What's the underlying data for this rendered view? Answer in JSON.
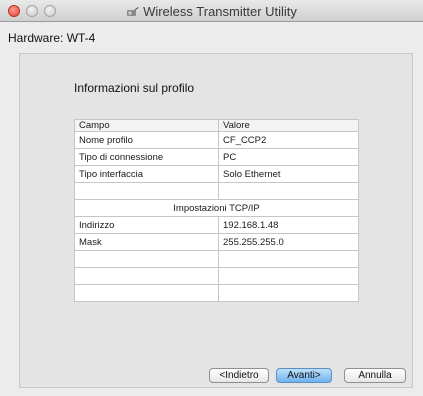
{
  "window": {
    "title": "Wireless Transmitter Utility"
  },
  "hardware_label": "Hardware: WT-4",
  "panel": {
    "heading": "Informazioni sul profilo"
  },
  "table": {
    "header": {
      "field": "Campo",
      "value": "Valore"
    },
    "rows": [
      {
        "field": "Nome profilo",
        "value": "CF_CCP2"
      },
      {
        "field": "Tipo di connessione",
        "value": "PC"
      },
      {
        "field": "Tipo interfaccia",
        "value": "Solo Ethernet"
      },
      {
        "field": "",
        "value": ""
      },
      {
        "section": "Impostazioni TCP/IP"
      },
      {
        "field": "Indirizzo",
        "value": "192.168.1.48"
      },
      {
        "field": "Mask",
        "value": "255.255.255.0"
      },
      {
        "field": "",
        "value": ""
      },
      {
        "field": "",
        "value": ""
      },
      {
        "field": "",
        "value": ""
      }
    ]
  },
  "buttons": {
    "back": "<Indietro",
    "next": "Avanti>",
    "cancel": "Annulla"
  },
  "icons": {
    "close": "traffic-light-close",
    "minimize": "traffic-light-minimize",
    "zoom": "traffic-light-zoom",
    "app": "wireless-transmitter-icon"
  },
  "colors": {
    "close_light": "#e0443a",
    "default_button": "#6fb2ef"
  }
}
